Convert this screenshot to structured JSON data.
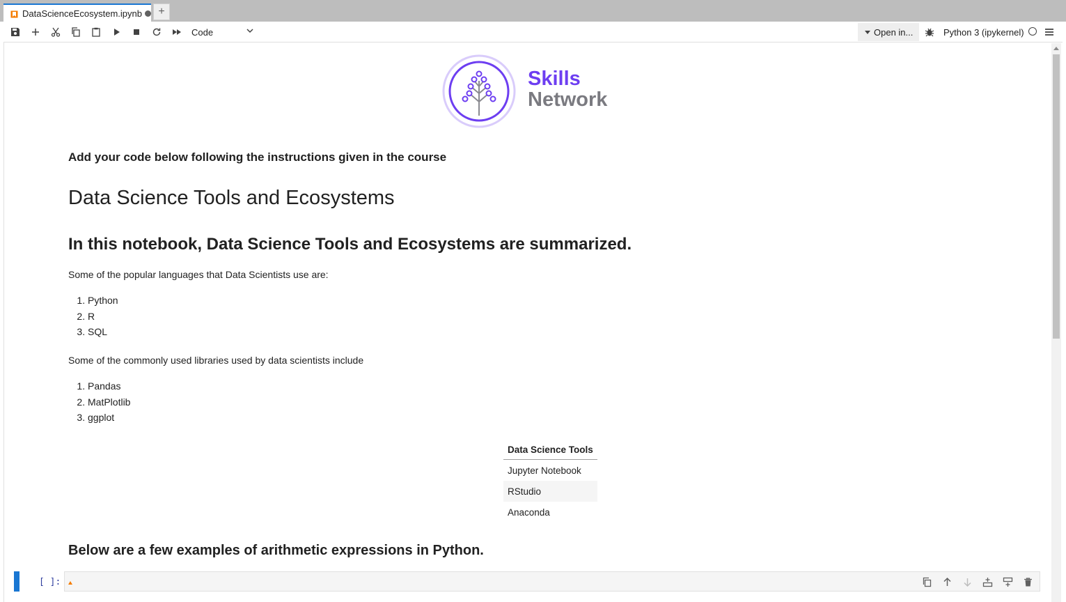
{
  "tab": {
    "title": "DataScienceEcosystem.ipynb"
  },
  "toolbar": {
    "cell_type": "Code",
    "open_in": "Open in...",
    "kernel_name": "Python 3 (ipykernel)"
  },
  "logo": {
    "line1": "Skills",
    "line2": "Network"
  },
  "notebook": {
    "instruction": "Add your code below following the instructions given in the course",
    "title": "Data Science Tools and Ecosystems",
    "intro": "In this notebook, Data Science Tools and Ecosystems are summarized.",
    "languages_intro": "Some of the popular languages that Data Scientists use are:",
    "languages": [
      "Python",
      "R",
      "SQL"
    ],
    "libraries_intro": "Some of the commonly used libraries used by data scientists include",
    "libraries": [
      "Pandas",
      "MatPlotlib",
      "ggplot"
    ],
    "tools_table": {
      "header": "Data Science Tools",
      "rows": [
        "Jupyter Notebook",
        "RStudio",
        "Anaconda"
      ]
    },
    "arithmetic_heading": "Below are a few examples of arithmetic expressions in Python."
  },
  "code_cell": {
    "prompt": "[ ]:"
  },
  "colors": {
    "accent": "#1976d2",
    "brand": "#6d3ef1"
  }
}
